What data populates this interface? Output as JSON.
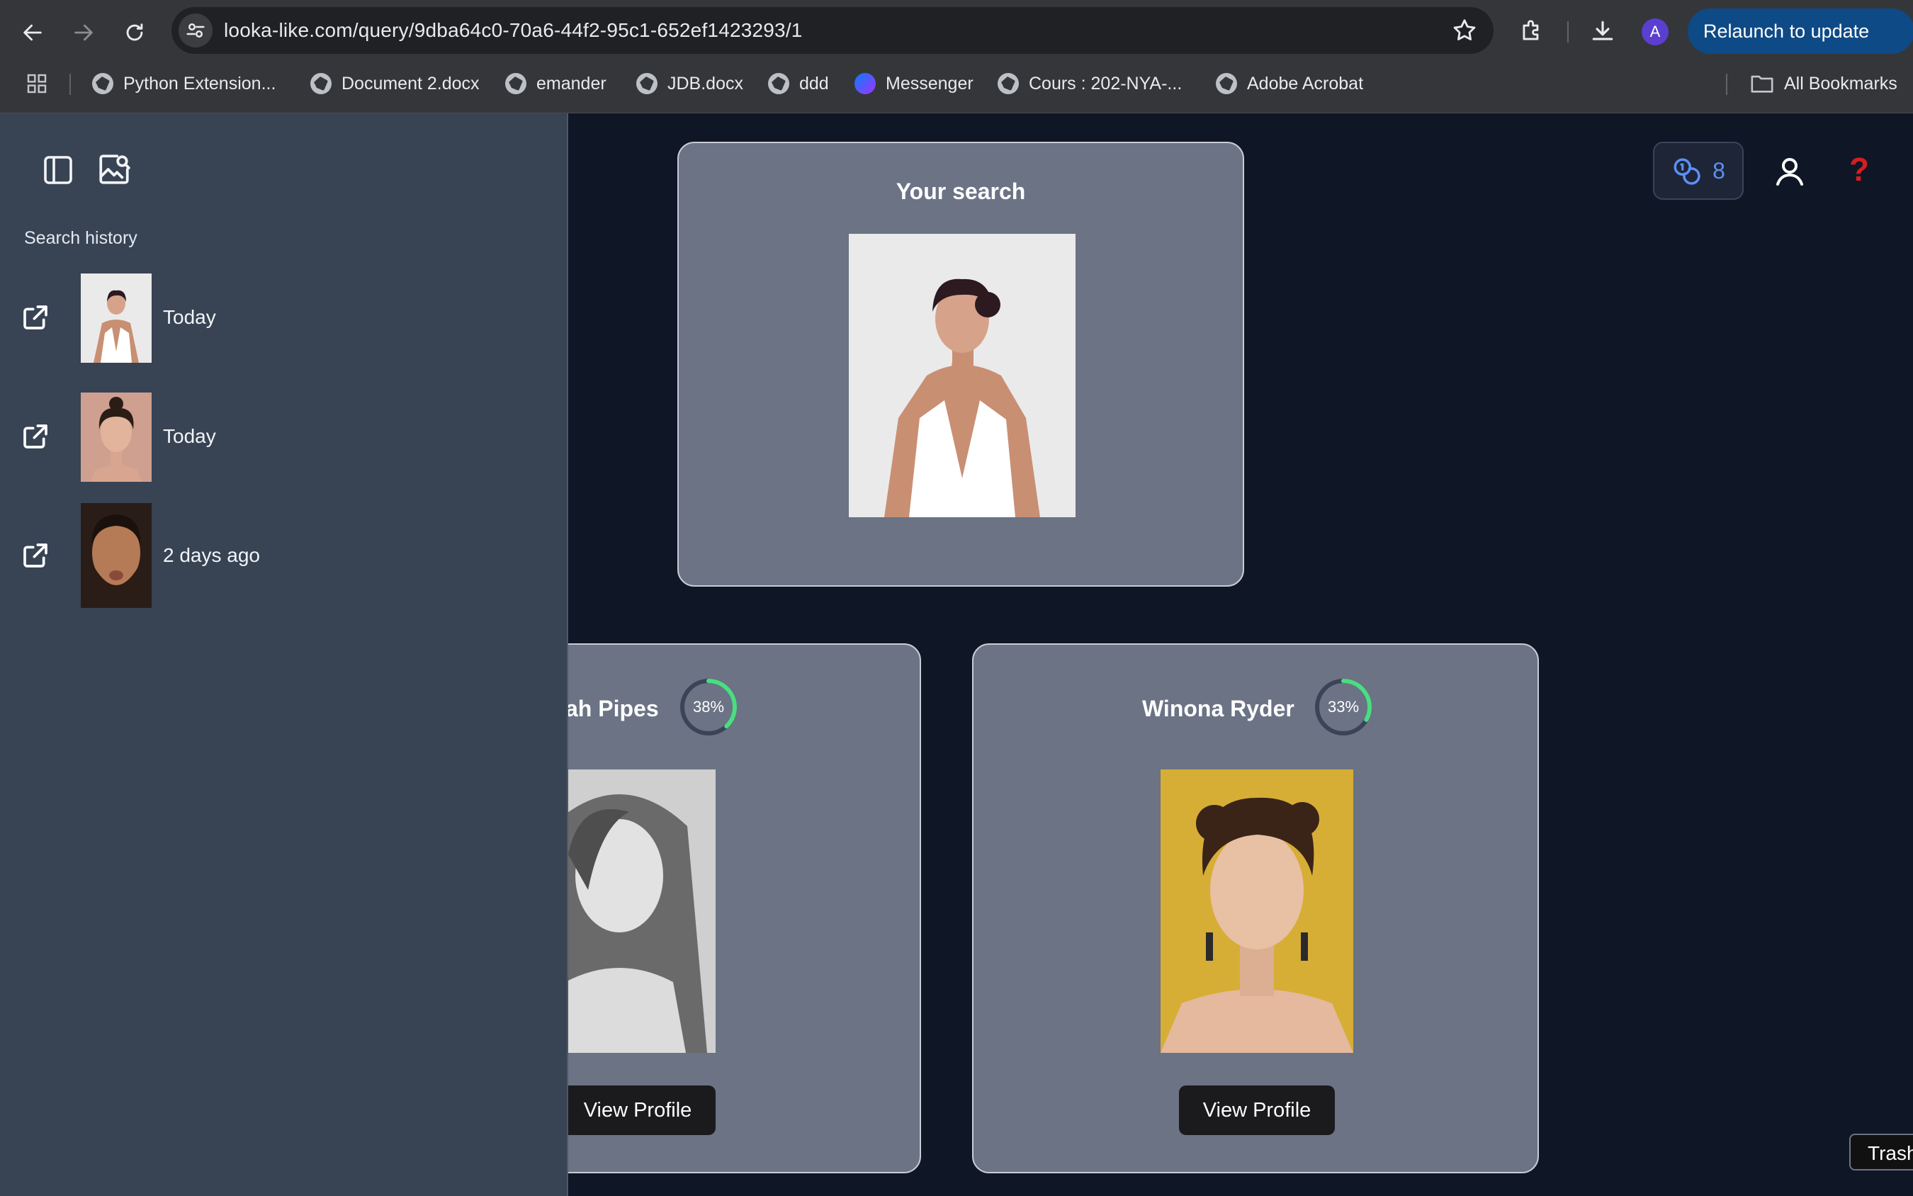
{
  "browser": {
    "url": "looka-like.com/query/9dba64c0-70a6-44f2-95c1-652ef1423293/1",
    "profile_initial": "A",
    "relaunch_label": "Relaunch to update",
    "icons": {
      "back": "back-arrow-icon",
      "forward": "forward-arrow-icon",
      "reload": "reload-icon",
      "site_info": "tune-icon",
      "bookmark_star": "star-icon",
      "extensions": "puzzle-icon",
      "downloads": "download-icon"
    }
  },
  "bookmarks": {
    "items": [
      {
        "label": "Python Extension...",
        "icon": "globe-icon"
      },
      {
        "label": "Document 2.docx",
        "icon": "globe-icon"
      },
      {
        "label": "emander",
        "icon": "globe-icon"
      },
      {
        "label": "JDB.docx",
        "icon": "globe-icon"
      },
      {
        "label": "ddd",
        "icon": "globe-icon"
      },
      {
        "label": "Messenger",
        "icon": "messenger-icon"
      },
      {
        "label": "Cours : 202-NYA-...",
        "icon": "globe-icon"
      },
      {
        "label": "Adobe Acrobat",
        "icon": "globe-icon"
      }
    ],
    "all_bookmarks_label": "All Bookmarks"
  },
  "sidebar": {
    "title": "Search history",
    "history": [
      {
        "time": "Today"
      },
      {
        "time": "Today"
      },
      {
        "time": "2 days ago"
      }
    ]
  },
  "header": {
    "credits_count": "8",
    "help_glyph": "?"
  },
  "search_card": {
    "title": "Your search"
  },
  "results": [
    {
      "name": "ah Pipes",
      "match_percent": 38,
      "match_label": "38%",
      "button_label": "View Profile"
    },
    {
      "name": "Winona Ryder",
      "match_percent": 33,
      "match_label": "33%",
      "button_label": "View Profile"
    }
  ],
  "tooltip": {
    "label": "Trash"
  },
  "colors": {
    "page_bg": "#0f1626",
    "sidebar_bg": "#384354",
    "card_bg": "#6b7385",
    "ring_progress": "#4ade80",
    "ring_track": "#3b4456",
    "credits_accent": "#5d8ff7",
    "help_red": "#d21f1f",
    "relaunch_bg": "#0e4a86"
  }
}
